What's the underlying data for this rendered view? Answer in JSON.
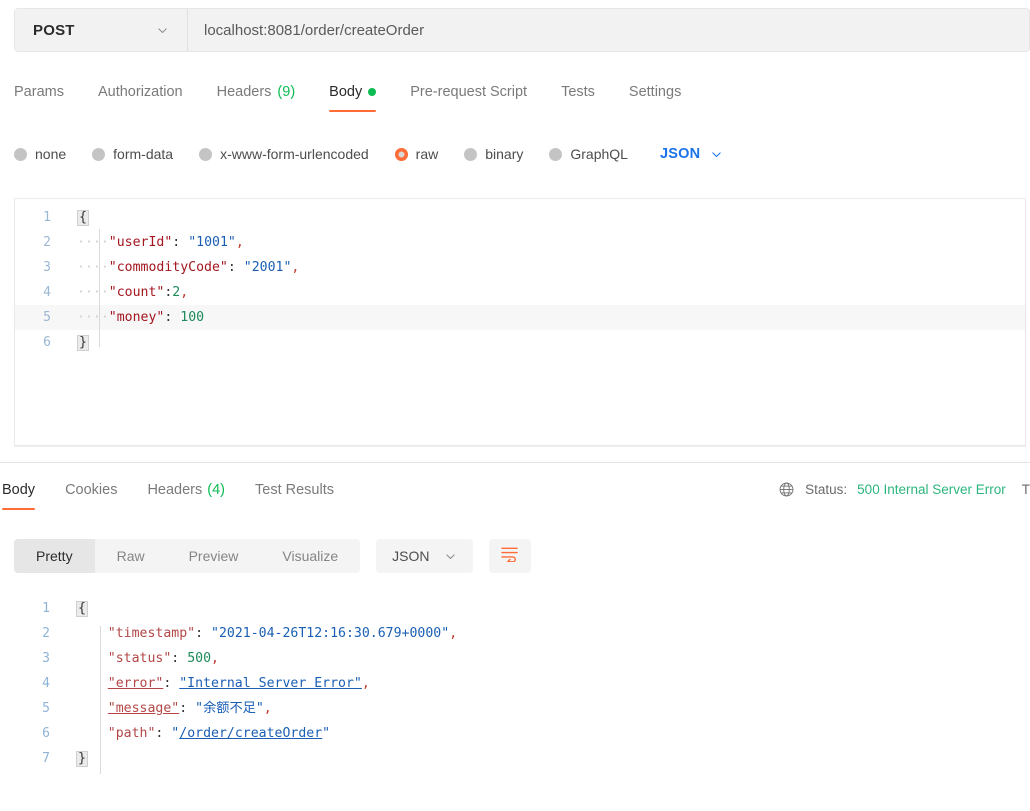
{
  "request": {
    "method": "POST",
    "url": "localhost:8081/order/createOrder",
    "tabs": [
      {
        "label": "Params",
        "active": false
      },
      {
        "label": "Authorization",
        "active": false
      },
      {
        "label": "Headers",
        "count": "(9)",
        "active": false
      },
      {
        "label": "Body",
        "active": true,
        "dot": true
      },
      {
        "label": "Pre-request Script",
        "active": false
      },
      {
        "label": "Tests",
        "active": false
      },
      {
        "label": "Settings",
        "active": false
      }
    ],
    "body_types": [
      {
        "label": "none",
        "selected": false
      },
      {
        "label": "form-data",
        "selected": false
      },
      {
        "label": "x-www-form-urlencoded",
        "selected": false
      },
      {
        "label": "raw",
        "selected": true
      },
      {
        "label": "binary",
        "selected": false
      },
      {
        "label": "GraphQL",
        "selected": false
      }
    ],
    "raw_format": "JSON",
    "body_lines": [
      "1",
      "2",
      "3",
      "4",
      "5",
      "6"
    ],
    "body_code": {
      "l1_brace": "{",
      "l2_dots": "····",
      "l2_key": "\"userId\"",
      "l2_colon": ":",
      "l2_space": " ",
      "l2_val": "\"1001\"",
      "l2_comma": ",",
      "l3_dots": "····",
      "l3_key": "\"commodityCode\"",
      "l3_colon": ":",
      "l3_space": " ",
      "l3_val": "\"2001\"",
      "l3_comma": ",",
      "l4_dots": "····",
      "l4_key": "\"count\"",
      "l4_colon": ":",
      "l4_val": "2",
      "l4_comma": ",",
      "l5_dots": "····",
      "l5_key": "\"money\"",
      "l5_colon": ":",
      "l5_space": " ",
      "l5_val": "100",
      "l6_brace": "}"
    }
  },
  "response": {
    "tabs": [
      {
        "label": "Body",
        "active": true
      },
      {
        "label": "Cookies",
        "active": false
      },
      {
        "label": "Headers",
        "count": "(4)",
        "active": false
      },
      {
        "label": "Test Results",
        "active": false
      }
    ],
    "status_label": "Status:",
    "status_value": "500 Internal Server Error",
    "time_label_truncated": "T",
    "view_modes": [
      {
        "label": "Pretty",
        "active": true
      },
      {
        "label": "Raw",
        "active": false
      },
      {
        "label": "Preview",
        "active": false
      },
      {
        "label": "Visualize",
        "active": false
      }
    ],
    "format": "JSON",
    "body_lines": [
      "1",
      "2",
      "3",
      "4",
      "5",
      "6",
      "7"
    ],
    "body_code": {
      "l1_brace": "{",
      "l2_key": "\"timestamp\"",
      "l2_colon": ": ",
      "l2_val": "\"2021-04-26T12:16:30.679+0000\"",
      "l2_comma": ",",
      "l3_key": "\"status\"",
      "l3_colon": ": ",
      "l3_val": "500",
      "l3_comma": ",",
      "l4_key": "\"error\"",
      "l4_colon": ": ",
      "l4_val": "\"Internal Server Error\"",
      "l4_comma": ",",
      "l5_key": "\"message\"",
      "l5_colon": ": ",
      "l5_quote_open": "\"",
      "l5_val": "余额不足",
      "l5_quote_close": "\"",
      "l5_comma": ",",
      "l6_key": "\"path\"",
      "l6_colon": ": ",
      "l6_quote_open": "\"",
      "l6_val": "/order/createOrder",
      "l6_quote_close": "\"",
      "l7_brace": "}"
    }
  },
  "colors": {
    "accent": "#ff6c37",
    "json_blue": "#1a73e8",
    "success_green": "#0cbb52",
    "status_green": "#2cb67d"
  },
  "icons": {
    "method_chevron": "chevron-down-icon",
    "json_chevron": "chevron-down-icon",
    "globe": "globe-icon",
    "wrap": "word-wrap-icon"
  }
}
